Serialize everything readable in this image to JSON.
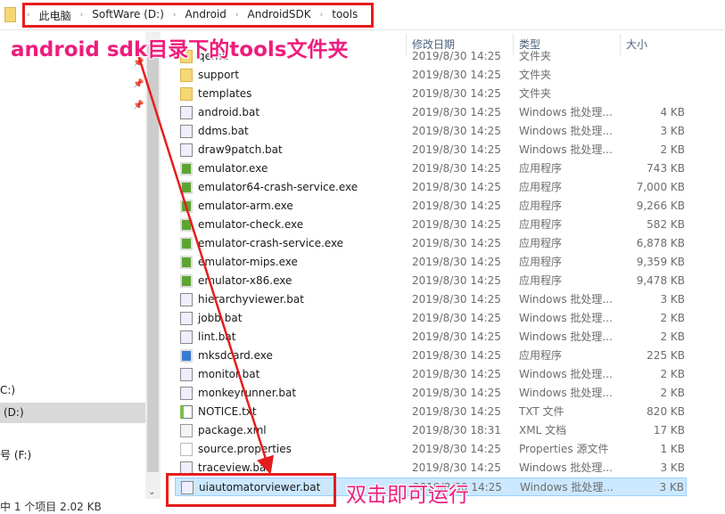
{
  "breadcrumb": [
    "此电脑",
    "SoftWare (D:)",
    "Android",
    "AndroidSDK",
    "tools"
  ],
  "columns": {
    "date": "修改日期",
    "type": "类型",
    "size": "大小"
  },
  "sidebar": {
    "drives": [
      "C:)",
      "(D:)",
      "号 (F:)"
    ]
  },
  "files": [
    {
      "name": "qemu",
      "date": "2019/8/30 14:25",
      "type": "文件夹",
      "size": "",
      "icon": "folder"
    },
    {
      "name": "support",
      "date": "2019/8/30 14:25",
      "type": "文件夹",
      "size": "",
      "icon": "folder"
    },
    {
      "name": "templates",
      "date": "2019/8/30 14:25",
      "type": "文件夹",
      "size": "",
      "icon": "folder"
    },
    {
      "name": "android.bat",
      "date": "2019/8/30 14:25",
      "type": "Windows 批处理...",
      "size": "4 KB",
      "icon": "bat"
    },
    {
      "name": "ddms.bat",
      "date": "2019/8/30 14:25",
      "type": "Windows 批处理...",
      "size": "3 KB",
      "icon": "bat"
    },
    {
      "name": "draw9patch.bat",
      "date": "2019/8/30 14:25",
      "type": "Windows 批处理...",
      "size": "2 KB",
      "icon": "bat"
    },
    {
      "name": "emulator.exe",
      "date": "2019/8/30 14:25",
      "type": "应用程序",
      "size": "743 KB",
      "icon": "exe"
    },
    {
      "name": "emulator64-crash-service.exe",
      "date": "2019/8/30 14:25",
      "type": "应用程序",
      "size": "7,000 KB",
      "icon": "exe"
    },
    {
      "name": "emulator-arm.exe",
      "date": "2019/8/30 14:25",
      "type": "应用程序",
      "size": "9,266 KB",
      "icon": "exe"
    },
    {
      "name": "emulator-check.exe",
      "date": "2019/8/30 14:25",
      "type": "应用程序",
      "size": "582 KB",
      "icon": "exe"
    },
    {
      "name": "emulator-crash-service.exe",
      "date": "2019/8/30 14:25",
      "type": "应用程序",
      "size": "6,878 KB",
      "icon": "exe"
    },
    {
      "name": "emulator-mips.exe",
      "date": "2019/8/30 14:25",
      "type": "应用程序",
      "size": "9,359 KB",
      "icon": "exe"
    },
    {
      "name": "emulator-x86.exe",
      "date": "2019/8/30 14:25",
      "type": "应用程序",
      "size": "9,478 KB",
      "icon": "exe"
    },
    {
      "name": "hierarchyviewer.bat",
      "date": "2019/8/30 14:25",
      "type": "Windows 批处理...",
      "size": "3 KB",
      "icon": "bat"
    },
    {
      "name": "jobb.bat",
      "date": "2019/8/30 14:25",
      "type": "Windows 批处理...",
      "size": "2 KB",
      "icon": "bat"
    },
    {
      "name": "lint.bat",
      "date": "2019/8/30 14:25",
      "type": "Windows 批处理...",
      "size": "2 KB",
      "icon": "bat"
    },
    {
      "name": "mksdcard.exe",
      "date": "2019/8/30 14:25",
      "type": "应用程序",
      "size": "225 KB",
      "icon": "exe2"
    },
    {
      "name": "monitor.bat",
      "date": "2019/8/30 14:25",
      "type": "Windows 批处理...",
      "size": "2 KB",
      "icon": "bat"
    },
    {
      "name": "monkeyrunner.bat",
      "date": "2019/8/30 14:25",
      "type": "Windows 批处理...",
      "size": "2 KB",
      "icon": "bat"
    },
    {
      "name": "NOTICE.txt",
      "date": "2019/8/30 14:25",
      "type": "TXT 文件",
      "size": "820 KB",
      "icon": "txt"
    },
    {
      "name": "package.xml",
      "date": "2019/8/30 18:31",
      "type": "XML 文档",
      "size": "17 KB",
      "icon": "xml"
    },
    {
      "name": "source.properties",
      "date": "2019/8/30 14:25",
      "type": "Properties 源文件",
      "size": "1 KB",
      "icon": "prop"
    },
    {
      "name": "traceview.bat",
      "date": "2019/8/30 14:25",
      "type": "Windows 批处理...",
      "size": "3 KB",
      "icon": "bat"
    },
    {
      "name": "uiautomatorviewer.bat",
      "date": "2019/8/30 14:25",
      "type": "Windows 批处理...",
      "size": "3 KB",
      "icon": "bat",
      "selected": true
    }
  ],
  "status": "中 1 个项目  2.02 KB",
  "annotations": {
    "top": "android sdk目录下的tools文件夹",
    "bottom": "双击即可运行",
    "color": "#e51d1d",
    "text_color": "#ee1d7c"
  }
}
